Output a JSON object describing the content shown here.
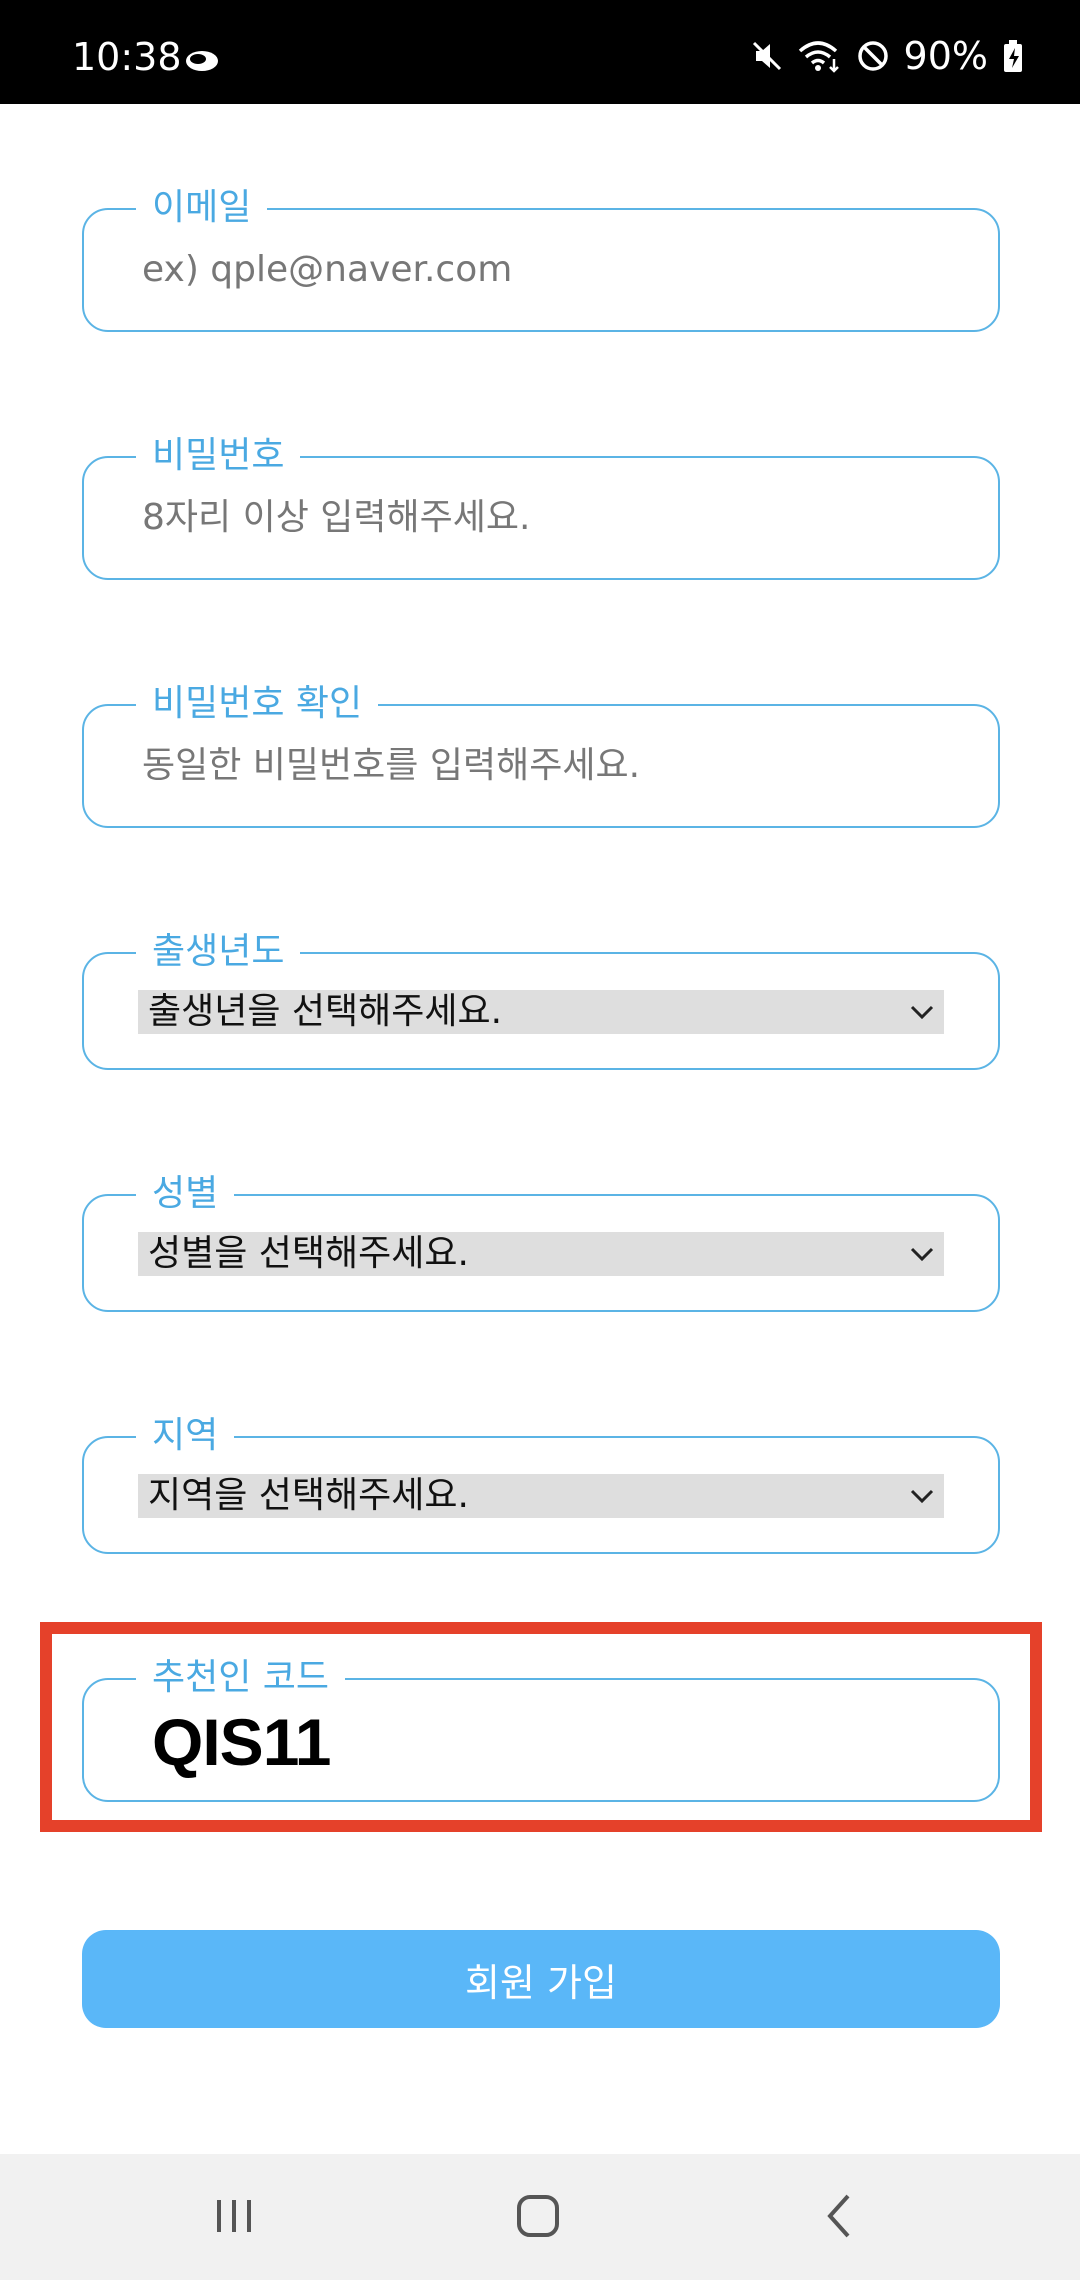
{
  "status_bar": {
    "time": "10:38",
    "battery_percent": "90%",
    "icons": [
      "cloud-icon",
      "mute-icon",
      "wifi-icon",
      "do-not-disturb-icon",
      "battery-charging-icon"
    ]
  },
  "form": {
    "email": {
      "label": "이메일",
      "placeholder": "ex) qple@naver.com"
    },
    "password": {
      "label": "비밀번호",
      "placeholder": "8자리 이상 입력해주세요."
    },
    "password_confirm": {
      "label": "비밀번호 확인",
      "placeholder": "동일한 비밀번호를 입력해주세요."
    },
    "birth_year": {
      "label": "출생년도",
      "selected": "출생년을 선택해주세요."
    },
    "gender": {
      "label": "성별",
      "selected": "성별을 선택해주세요."
    },
    "region": {
      "label": "지역",
      "selected": "지역을 선택해주세요."
    },
    "referral": {
      "label": "추천인 코드",
      "value": "QIS11"
    },
    "submit_label": "회원 가입"
  },
  "colors": {
    "accent": "#4aa9e2",
    "field_border": "#5bb4e5",
    "button": "#5ab7f8",
    "highlight": "#e5412a"
  },
  "nav_bar": {
    "icons": [
      "recent-apps-icon",
      "home-icon",
      "back-icon"
    ]
  }
}
